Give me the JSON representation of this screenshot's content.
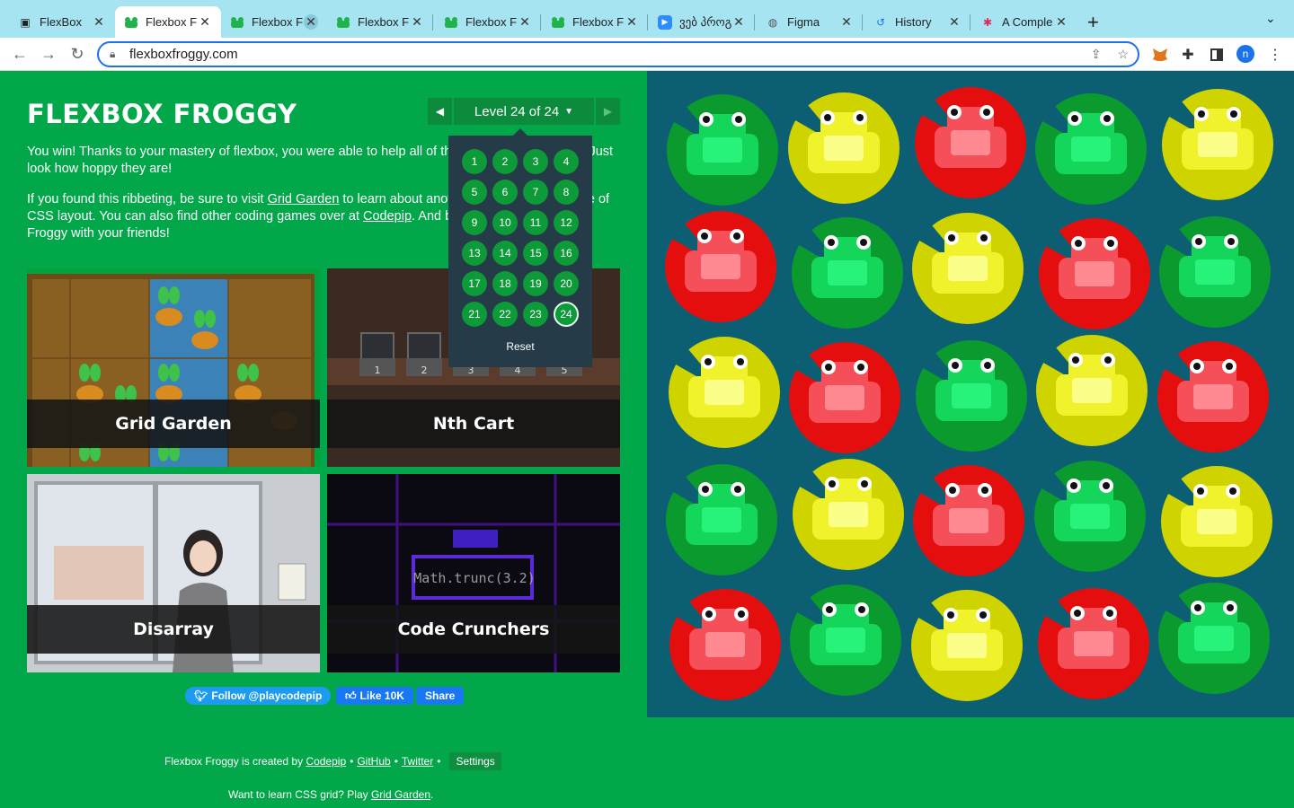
{
  "browser": {
    "tabs": [
      {
        "title": "FlexBox",
        "icon": "page-icon"
      },
      {
        "title": "Flexbox F",
        "icon": "frog-icon"
      },
      {
        "title": "Flexbox F",
        "icon": "frog-icon"
      },
      {
        "title": "Flexbox F",
        "icon": "frog-icon"
      },
      {
        "title": "Flexbox F",
        "icon": "frog-icon"
      },
      {
        "title": "Flexbox F",
        "icon": "frog-icon"
      },
      {
        "title": "ვებ პროგ",
        "icon": "zoom-icon"
      },
      {
        "title": "Figma",
        "icon": "globe-icon"
      },
      {
        "title": "History",
        "icon": "history-icon"
      },
      {
        "title": "A Comple",
        "icon": "star-icon"
      }
    ],
    "url": "flexboxfroggy.com",
    "profile_initial": "n"
  },
  "page": {
    "logo": "FLEXBOX FROGGY",
    "level_label": "Level 24 of 24",
    "intro_1": "You win! Thanks to your mastery of flexbox, you were able to help all of the frogs to their lilypads. Just look how hoppy they are!",
    "intro_2_pre": "If you found this ribbeting, be sure to visit ",
    "intro_2_link1": "Grid Garden",
    "intro_2_mid": " to learn about another powerful new feature of CSS layout. You can also find other coding games over at ",
    "intro_2_link2": "Codepip",
    "intro_2_post": ". And be sure to share Flexbox Froggy with your friends!",
    "cards": {
      "garden": "Grid Garden",
      "cart": "Nth Cart",
      "disarray": "Disarray",
      "crunch": "Code Crunchers",
      "crunch_code": "Math.trunc(3.2)"
    },
    "social": {
      "twitter": "Follow @playcodepip",
      "like": "Like 10K",
      "share": "Share"
    },
    "footer": {
      "created": "Flexbox Froggy is created by",
      "codepip": "Codepip",
      "github": "GitHub",
      "twitter": "Twitter",
      "settings": "Settings",
      "grid_pre": "Want to learn CSS grid? Play ",
      "grid_link": "Grid Garden",
      "grid_post": "."
    },
    "dropdown": {
      "levels": [
        "1",
        "2",
        "3",
        "4",
        "5",
        "6",
        "7",
        "8",
        "9",
        "10",
        "11",
        "12",
        "13",
        "14",
        "15",
        "16",
        "17",
        "18",
        "19",
        "20",
        "21",
        "22",
        "23",
        "24"
      ],
      "current": "24",
      "reset": "Reset"
    }
  },
  "colors": {
    "bg": "#01a748",
    "pond": "#0c5f73",
    "green": "#0d9a38",
    "yellow": "#d6e000",
    "red": "#e31212"
  },
  "pond_frogs": [
    [
      "green",
      "yellow",
      "red",
      "green",
      "yellow"
    ],
    [
      "red",
      "green",
      "yellow",
      "red",
      "green"
    ],
    [
      "yellow",
      "red",
      "green",
      "yellow",
      "red"
    ],
    [
      "green",
      "yellow",
      "red",
      "green",
      "yellow"
    ],
    [
      "red",
      "green",
      "yellow",
      "red",
      "green"
    ]
  ]
}
